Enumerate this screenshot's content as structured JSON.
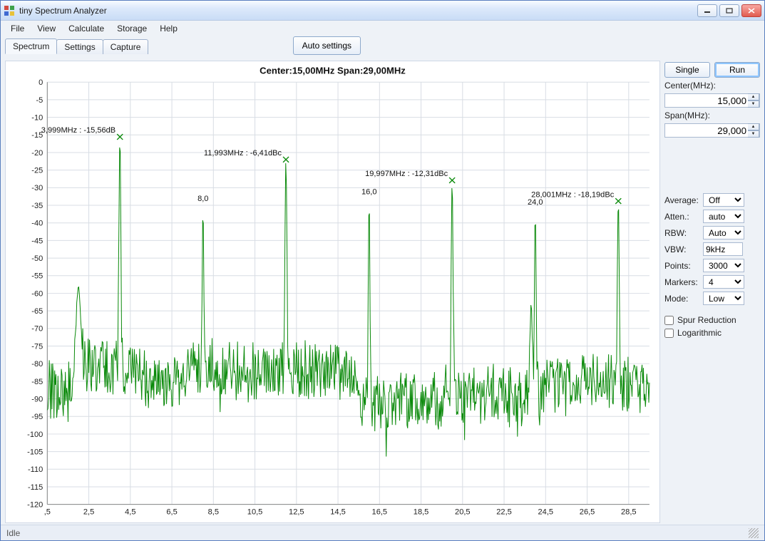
{
  "window": {
    "title": "tiny Spectrum Analyzer"
  },
  "menu": {
    "items": [
      "File",
      "View",
      "Calculate",
      "Storage",
      "Help"
    ]
  },
  "tabs": {
    "items": [
      "Spectrum",
      "Settings",
      "Capture"
    ],
    "active": 0
  },
  "toolbar": {
    "auto_settings": "Auto settings"
  },
  "side": {
    "single": "Single",
    "run": "Run",
    "center_lbl": "Center(MHz):",
    "center_val": "15,000",
    "span_lbl": "Span(MHz):",
    "span_val": "29,000",
    "average_lbl": "Average:",
    "average_val": "Off",
    "atten_lbl": "Atten.:",
    "atten_val": "auto",
    "rbw_lbl": "RBW:",
    "rbw_val": "Auto",
    "vbw_lbl": "VBW:",
    "vbw_val": "9kHz",
    "points_lbl": "Points:",
    "points_val": "3000",
    "markers_lbl": "Markers:",
    "markers_val": "4",
    "mode_lbl": "Mode:",
    "mode_val": "Low",
    "spur_lbl": "Spur Reduction",
    "log_lbl": "Logarithmic"
  },
  "status": {
    "text": "Idle"
  },
  "chart_data": {
    "type": "line",
    "title": "Center:15,00MHz Span:29,00MHz",
    "xlabel": "",
    "ylabel": "",
    "xlim": [
      0.5,
      29.5
    ],
    "ylim": [
      -120,
      0
    ],
    "x_ticks": [
      ",5",
      "2,5",
      "4,5",
      "6,5",
      "8,5",
      "10,5",
      "12,5",
      "14,5",
      "16,5",
      "18,5",
      "20,5",
      "22,5",
      "24,5",
      "26,5",
      "28,5"
    ],
    "y_ticks": [
      0,
      -5,
      -10,
      -15,
      -20,
      -25,
      -30,
      -35,
      -40,
      -45,
      -50,
      -55,
      -60,
      -65,
      -70,
      -75,
      -80,
      -85,
      -90,
      -95,
      -100,
      -105,
      -110,
      -115,
      -120
    ],
    "markers": [
      {
        "freq": 3.999,
        "level": -15.56,
        "label": "3,999MHz : -15,56dB"
      },
      {
        "freq": 11.993,
        "level": -6.41,
        "label": "11,993MHz : -6,41dBc",
        "plot_level": -22.0
      },
      {
        "freq": 19.997,
        "level": -12.31,
        "label": "19,997MHz : -12,31dBc",
        "plot_level": -27.9
      },
      {
        "freq": 28.001,
        "level": -18.19,
        "label": "28,001MHz : -18,19dBc",
        "plot_level": -33.8
      }
    ],
    "peaks_unmarked": [
      {
        "freq": 8.0,
        "level": -35,
        "label": "8,0"
      },
      {
        "freq": 16.0,
        "level": -33,
        "label": "16,0"
      },
      {
        "freq": 24.0,
        "level": -36,
        "label": "24,0"
      }
    ],
    "noise_floor_profile": {
      "avg_db": -85,
      "variance_db": 10,
      "segments": [
        {
          "from": 0.5,
          "to": 2.2,
          "bias": -3
        },
        {
          "from": 2.2,
          "to": 3.5,
          "bias": 4
        },
        {
          "from": 3.5,
          "to": 5.2,
          "bias": 3
        },
        {
          "from": 5.2,
          "to": 7.0,
          "bias": -1
        },
        {
          "from": 7.0,
          "to": 11.0,
          "bias": 3
        },
        {
          "from": 11.0,
          "to": 15.5,
          "bias": 3
        },
        {
          "from": 15.5,
          "to": 19.5,
          "bias": -6
        },
        {
          "from": 19.5,
          "to": 24.5,
          "bias": -4
        },
        {
          "from": 24.5,
          "to": 29.5,
          "bias": 0
        }
      ]
    }
  }
}
